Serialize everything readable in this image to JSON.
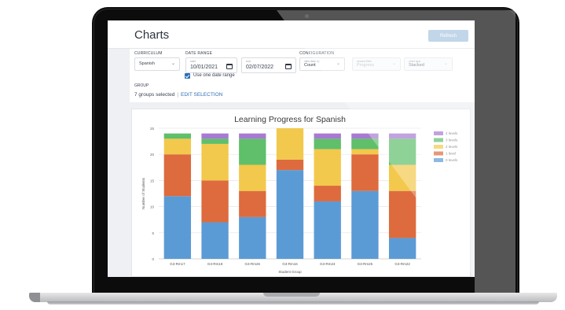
{
  "page": {
    "title": "Charts",
    "refresh_label": "Refresh"
  },
  "filters": {
    "curriculum_label": "CURRICULUM",
    "curriculum_value": "Spanish",
    "date_range_label": "DATE RANGE",
    "start_inner_label": "start",
    "start_date": "10/01/2021",
    "end_inner_label": "end",
    "end_date": "02/07/2022",
    "use_one_date_label": "Use one date range",
    "configuration_label": "CONFIGURATION",
    "view_data_inner": "view data by",
    "view_data_value": "Count",
    "second_inner": "second filter",
    "second_value": "Progress",
    "chart_type_inner": "chart type",
    "chart_type_value": "Stacked",
    "group_label": "GROUP",
    "groups_selected": "7 groups selected",
    "separator": "|",
    "edit_selection": "EDIT SELECTION"
  },
  "icons": {
    "chevron": "chevron-down-icon",
    "calendar": "calendar-icon",
    "checkbox": "checkbox-checked-icon"
  },
  "chart_data": {
    "type": "bar",
    "stacked": true,
    "title": "Learning Progress for Spanish",
    "xlabel": "Student Group",
    "ylabel": "Number of Students",
    "ylim": [
      0,
      25
    ],
    "yticks": [
      0,
      5,
      10,
      15,
      20,
      25
    ],
    "grid": true,
    "legend_position": "right",
    "categories": [
      "G3-Rm17",
      "G3-Rm18",
      "G3-Rm26",
      "G3-Rm16",
      "G3-Rm24",
      "G3-Rm25",
      "G3-Rm22"
    ],
    "series": [
      {
        "name": "0 levels",
        "color": "#5b9bd5",
        "values": [
          12,
          7,
          8,
          17,
          11,
          13,
          4
        ]
      },
      {
        "name": "1 level",
        "color": "#dd6b3d",
        "values": [
          8,
          8,
          5,
          2,
          3,
          7,
          9
        ]
      },
      {
        "name": "2 levels",
        "color": "#f2c94c",
        "values": [
          3,
          7,
          5,
          6,
          7,
          1,
          5
        ]
      },
      {
        "name": "3 levels",
        "color": "#5fbf6a",
        "values": [
          1,
          1,
          5,
          0,
          2,
          2,
          5
        ]
      },
      {
        "name": "4 levels",
        "color": "#a77bd1",
        "values": [
          0,
          1,
          1,
          0,
          1,
          1,
          1
        ]
      }
    ]
  }
}
